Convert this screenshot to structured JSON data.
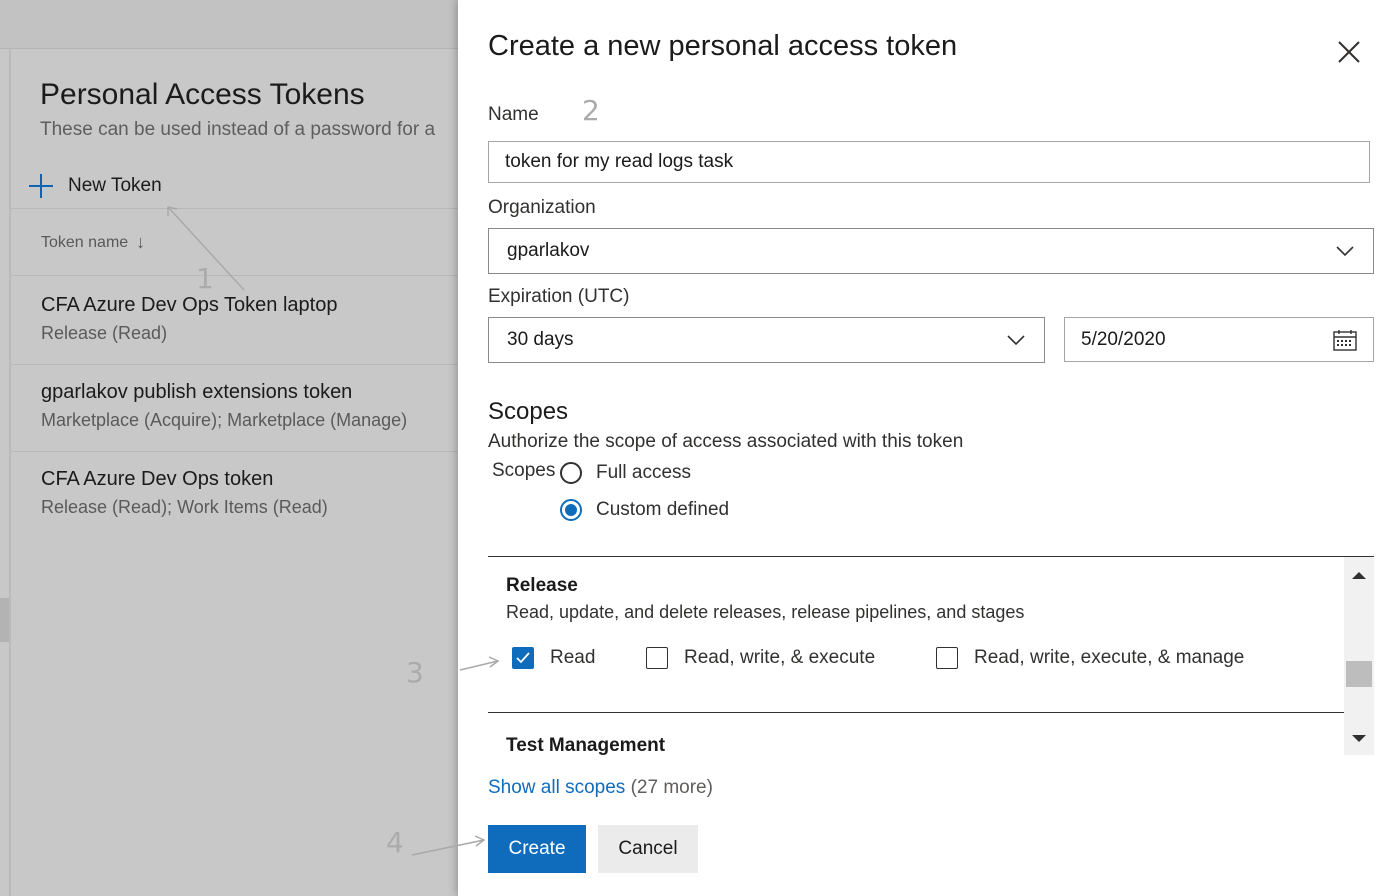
{
  "background": {
    "title": "Personal Access Tokens",
    "subtitle": "These can be used instead of a password for a",
    "new_token_label": "New Token",
    "column_header": "Token name",
    "rows": [
      {
        "name": "CFA Azure Dev Ops Token laptop",
        "scopes": "Release (Read)"
      },
      {
        "name": "gparlakov publish extensions token",
        "scopes": "Marketplace (Acquire); Marketplace (Manage)"
      },
      {
        "name": "CFA Azure Dev Ops token",
        "scopes": "Release (Read); Work Items (Read)"
      }
    ]
  },
  "annotations": {
    "step1": "1",
    "step2": "2",
    "step3": "3",
    "step4": "4"
  },
  "dialog": {
    "title": "Create a new personal access token",
    "name_label": "Name",
    "name_value": "token for my read logs task",
    "organization_label": "Organization",
    "organization_value": "gparlakov",
    "expiration_label": "Expiration (UTC)",
    "expiration_value": "30 days",
    "expiration_date": "5/20/2020",
    "scopes_heading": "Scopes",
    "scopes_description": "Authorize the scope of access associated with this token",
    "scopes_label": "Scopes",
    "scope_options": [
      {
        "label": "Full access",
        "selected": false
      },
      {
        "label": "Custom defined",
        "selected": true
      }
    ],
    "scope_sections": [
      {
        "title": "Release",
        "description": "Read, update, and delete releases, release pipelines, and stages",
        "options": [
          {
            "label": "Read",
            "checked": true
          },
          {
            "label": "Read, write, & execute",
            "checked": false
          },
          {
            "label": "Read, write, execute, & manage",
            "checked": false
          }
        ]
      },
      {
        "title": "Test Management"
      }
    ],
    "show_all_link": "Show all scopes",
    "show_all_more": "(27 more)",
    "create_button": "Create",
    "cancel_button": "Cancel"
  },
  "colors": {
    "accent": "#0f6cbd",
    "overlay_gray": "#c8c8c8"
  },
  "icons": [
    "plus-icon",
    "sort-down-icon",
    "close-icon",
    "chevron-down-icon",
    "calendar-icon",
    "checkmark-icon",
    "scroll-up-icon",
    "scroll-down-icon"
  ]
}
